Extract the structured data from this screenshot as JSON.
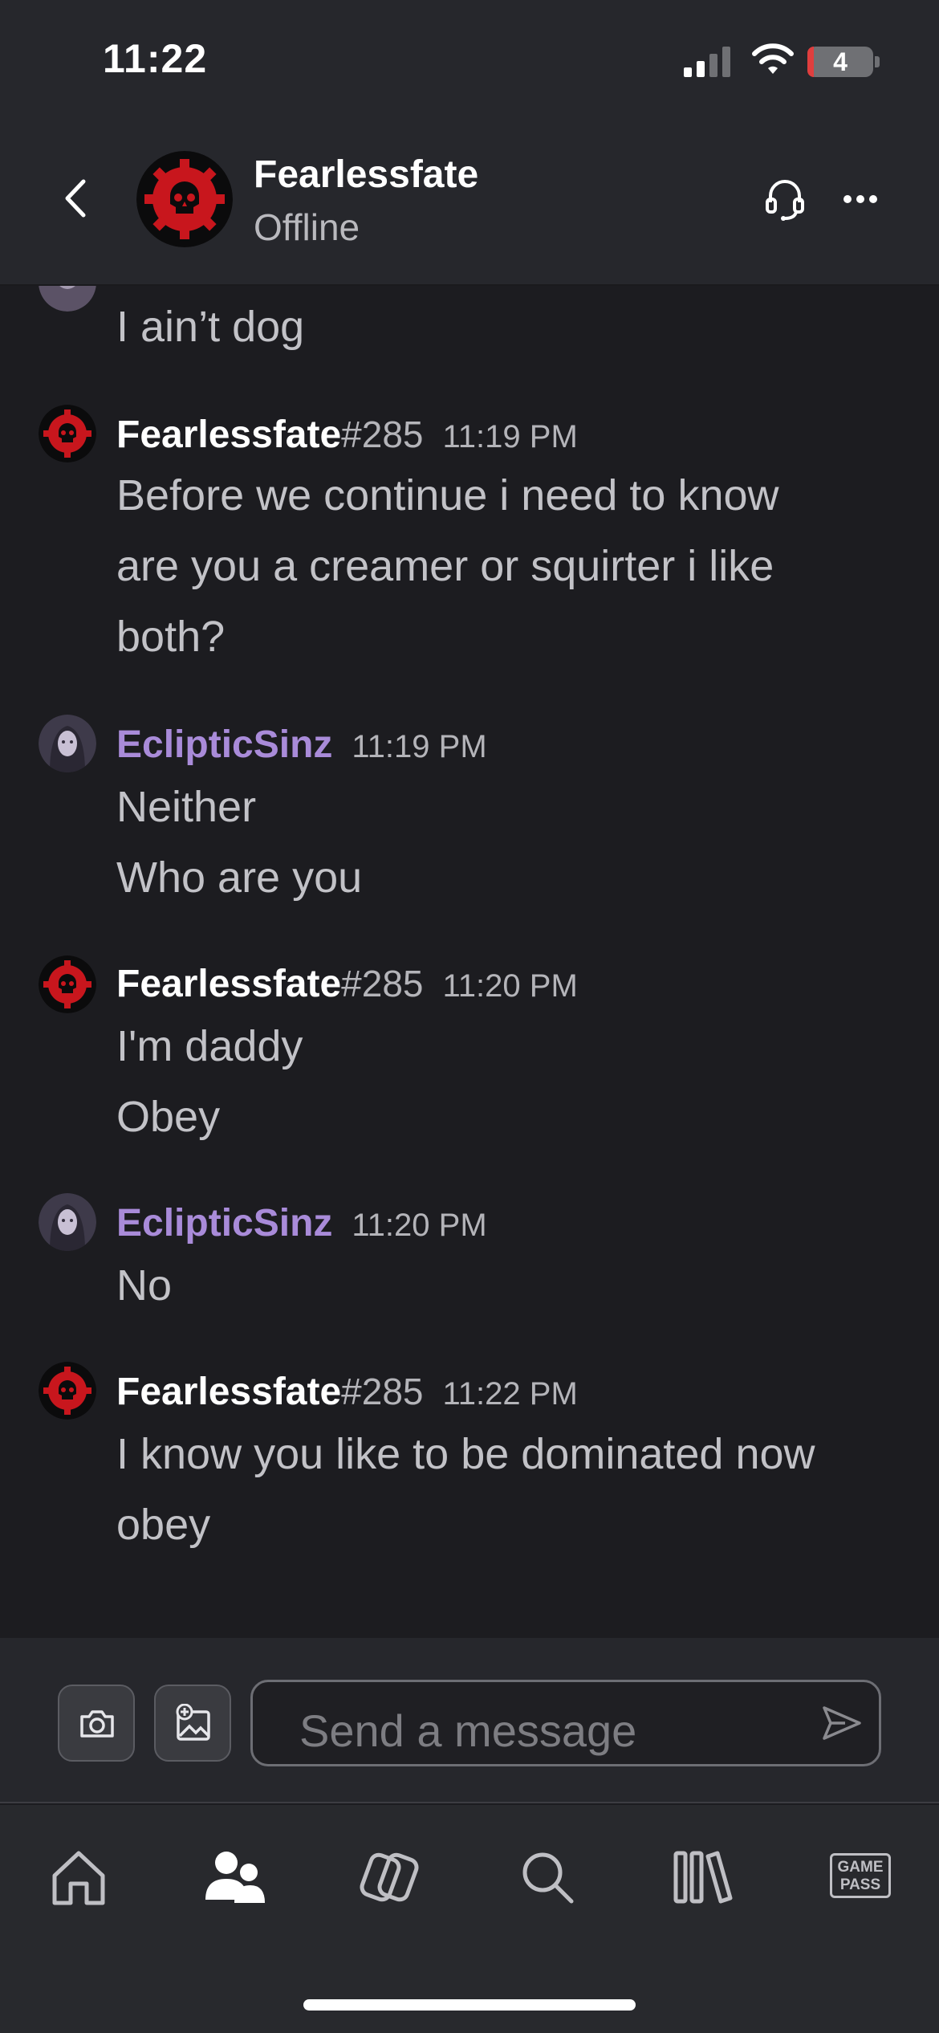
{
  "status_bar": {
    "time": "11:22",
    "battery_level": "4"
  },
  "header": {
    "contact_name": "Fearlessfate",
    "contact_status": "Offline"
  },
  "messages": [
    {
      "author": "",
      "tag": "",
      "time": "",
      "lines": [
        "I ain’t dog"
      ]
    },
    {
      "author": "Fearlessfate",
      "tag": "#285",
      "time": "11:19 PM",
      "lines": [
        "Before we continue i need to know",
        "are you a creamer or squirter i like",
        "both?"
      ]
    },
    {
      "author": "EclipticSinz",
      "tag": "",
      "time": "11:19 PM",
      "lines": [
        "Neither",
        "Who are you"
      ]
    },
    {
      "author": "Fearlessfate",
      "tag": "#285",
      "time": "11:20 PM",
      "lines": [
        "I'm daddy",
        "Obey"
      ]
    },
    {
      "author": "EclipticSinz",
      "tag": "",
      "time": "11:20 PM",
      "lines": [
        "No"
      ]
    },
    {
      "author": "Fearlessfate",
      "tag": "#285",
      "time": "11:22 PM",
      "lines": [
        "I know you like to be dominated now",
        "obey"
      ]
    }
  ],
  "composer": {
    "placeholder": "Send a message"
  },
  "tabbar": {
    "gamepass_line1": "GAME",
    "gamepass_line2": "PASS"
  },
  "colors": {
    "background": "#1c1c20",
    "header": "#26272c",
    "ecliptic_name": "#a98bd9",
    "gears_red": "#c8161d"
  },
  "icons": [
    "back-icon",
    "party-chat-icon",
    "more-icon",
    "camera-icon",
    "image-add-icon",
    "send-icon",
    "home-icon",
    "social-icon",
    "store-icon",
    "search-icon",
    "library-icon",
    "game-pass-icon"
  ]
}
